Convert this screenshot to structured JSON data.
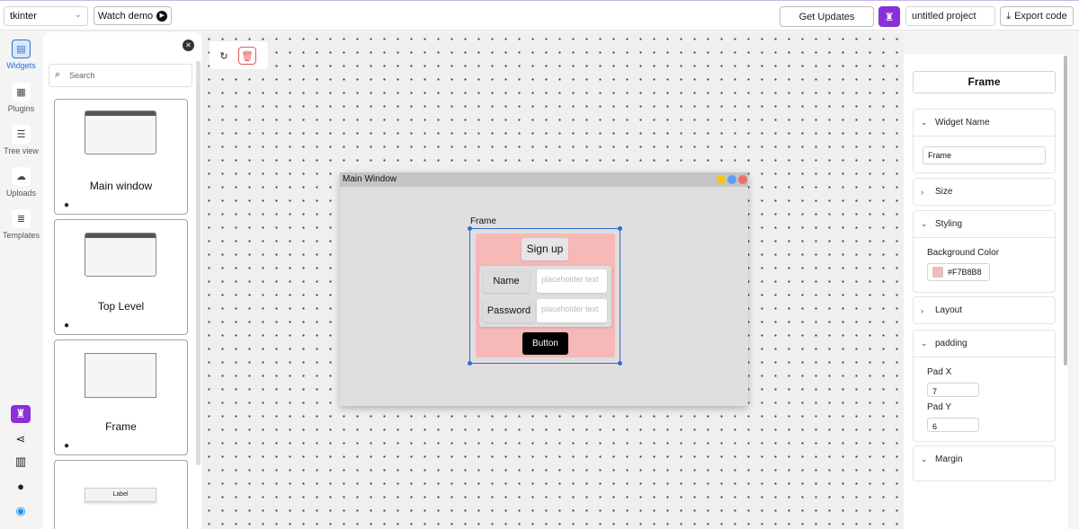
{
  "topbar": {
    "framework": "tkinter",
    "watch_demo": "Watch demo",
    "get_updates": "Get Updates",
    "project_name": "untitled project",
    "export": "Export code"
  },
  "nav": [
    {
      "label": "Widgets",
      "icon": "widgets-icon"
    },
    {
      "label": "Plugins",
      "icon": "plugins-icon"
    },
    {
      "label": "Tree view",
      "icon": "tree-view-icon"
    },
    {
      "label": "Uploads",
      "icon": "uploads-icon"
    },
    {
      "label": "Templates",
      "icon": "templates-icon"
    }
  ],
  "widgets_panel": {
    "search_placeholder": "Search",
    "cards": [
      {
        "name": "Main window"
      },
      {
        "name": "Top Level"
      },
      {
        "name": "Frame"
      },
      {
        "preview_label": "Label"
      }
    ]
  },
  "canvas": {
    "main_window_title": "Main Window",
    "frame_label": "Frame",
    "signup": "Sign up",
    "name_label": "Name",
    "password_label": "Password",
    "name_placeholder": "placeholder text",
    "password_placeholder": "placeholder text",
    "button": "Button",
    "frame_bg": "#F7B8B8"
  },
  "properties": {
    "title": "Frame",
    "widget_name_section": "Widget Name",
    "widget_name_value": "Frame",
    "size_section": "Size",
    "styling_section": "Styling",
    "bg_label": "Background Color",
    "bg_value": "#F7B8B8",
    "layout_section": "Layout",
    "padding_section": "padding",
    "pad_x_label": "Pad X",
    "pad_x_value": "7",
    "pad_y_label": "Pad Y",
    "pad_y_value": "6",
    "margin_section": "Margin"
  },
  "colors": {
    "accent": "#2b6fd6",
    "brand": "#8b2fd9"
  }
}
